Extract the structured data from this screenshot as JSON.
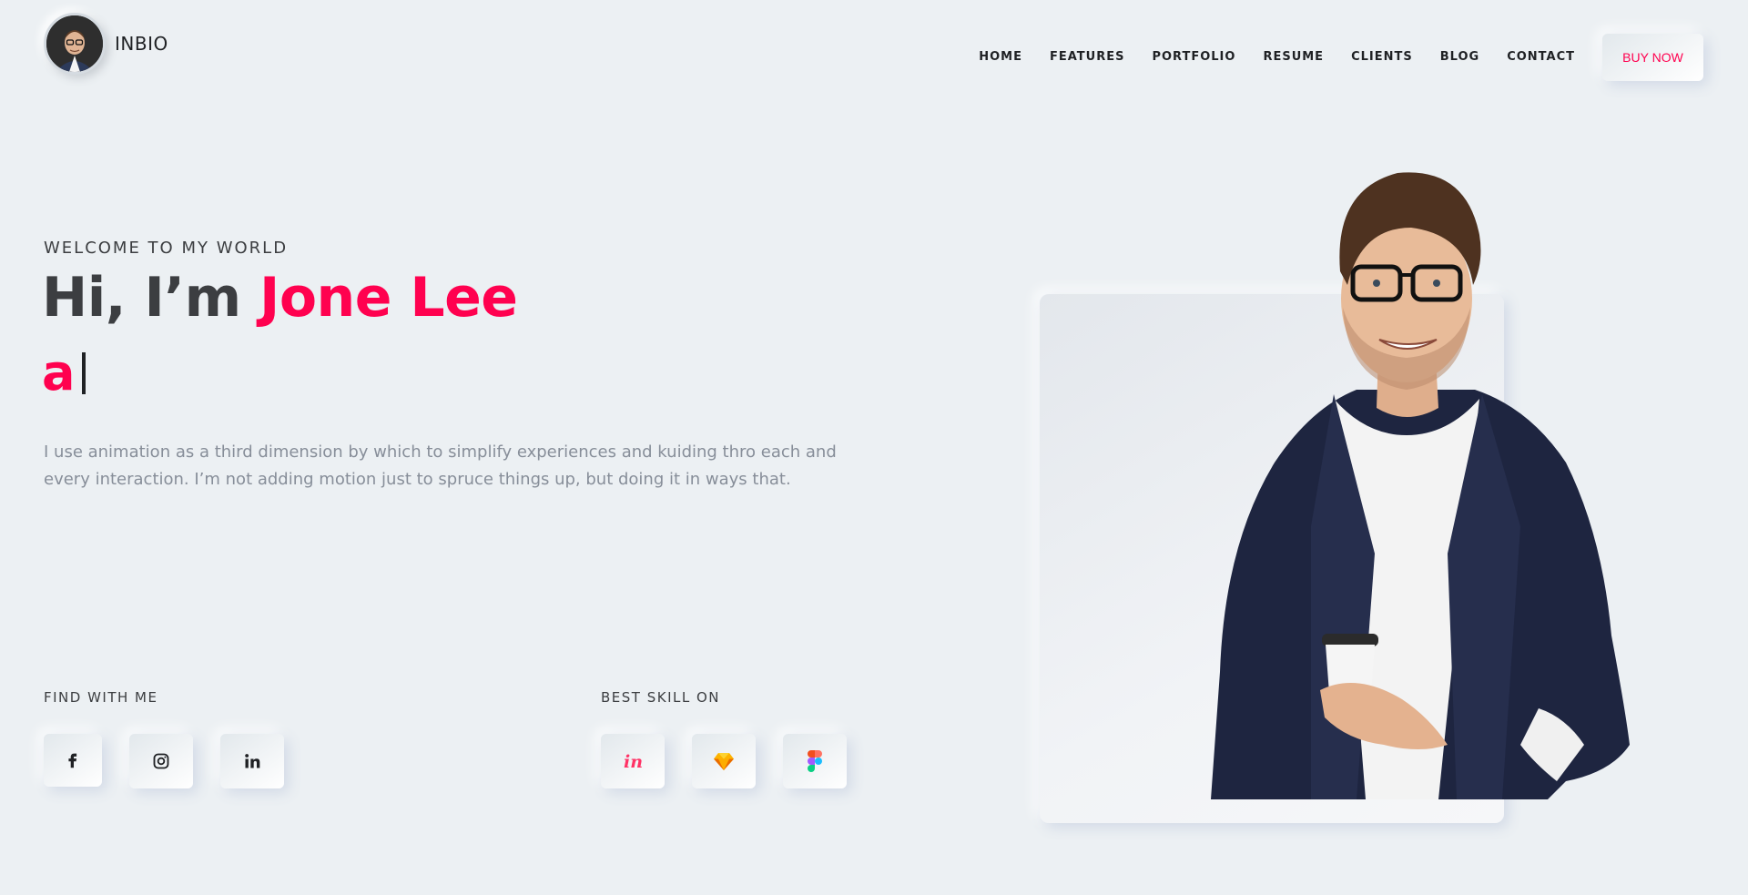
{
  "header": {
    "brand": "INBIO",
    "nav": [
      "HOME",
      "FEATURES",
      "PORTFOLIO",
      "RESUME",
      "CLIENTS",
      "BLOG",
      "CONTACT"
    ],
    "buy_label": "BUY NOW"
  },
  "hero": {
    "welcome": "WELCOME TO MY WORLD",
    "greeting": "Hi, I’m ",
    "name": "Jone Lee",
    "typed": "a",
    "description": "I use animation as a third dimension by which to simplify experiences and kuiding thro each and every interaction. I’m not adding motion just to spruce things up, but doing it in ways that."
  },
  "find": {
    "label": "FIND WITH ME",
    "icons": [
      "facebook-icon",
      "instagram-icon",
      "linkedin-icon"
    ]
  },
  "skills": {
    "label": "BEST SKILL ON",
    "icons": [
      "invision-icon",
      "sketch-icon",
      "figma-icon"
    ]
  },
  "colors": {
    "background": "#ecf0f3",
    "accent": "#ff014f",
    "heading": "#3c3e41",
    "body_text": "#878e99"
  }
}
